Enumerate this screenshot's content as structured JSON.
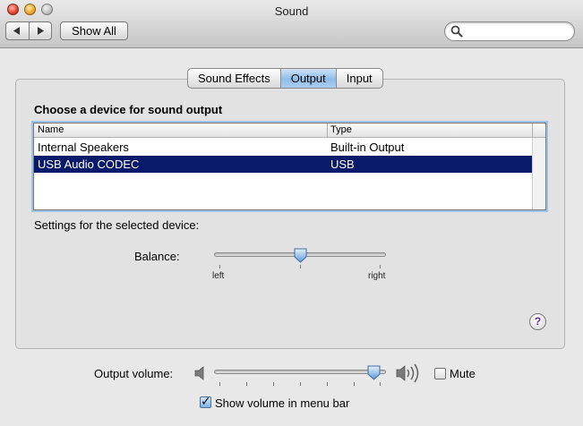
{
  "window": {
    "title": "Sound"
  },
  "toolbar": {
    "back_icon": "left-arrow-icon",
    "forward_icon": "right-arrow-icon",
    "show_all_label": "Show All",
    "search": {
      "value": "",
      "placeholder": "",
      "icon": "magnifier-icon"
    }
  },
  "tabs": [
    {
      "label": "Sound Effects",
      "active": false
    },
    {
      "label": "Output",
      "active": true
    },
    {
      "label": "Input",
      "active": false
    }
  ],
  "device_section": {
    "title": "Choose a device for sound output",
    "columns": [
      "Name",
      "Type"
    ],
    "rows": [
      {
        "name": "Internal Speakers",
        "type": "Built-in Output",
        "selected": false
      },
      {
        "name": "USB Audio CODEC",
        "type": "USB",
        "selected": true
      }
    ],
    "selection_color": "#0a1a6b"
  },
  "settings": {
    "title": "Settings for the selected device:",
    "balance_label": "Balance:",
    "balance_left_label": "left",
    "balance_right_label": "right",
    "balance_value": 0.5
  },
  "help_icon": "question-mark-icon",
  "help_glyph": "?",
  "output_volume": {
    "label": "Output volume:",
    "value": 0.95,
    "min_icon": "speaker-low-icon",
    "max_icon": "speaker-high-icon",
    "mute_label": "Mute",
    "muted": false
  },
  "menu_bar": {
    "label": "Show volume in menu bar",
    "checked": true
  }
}
